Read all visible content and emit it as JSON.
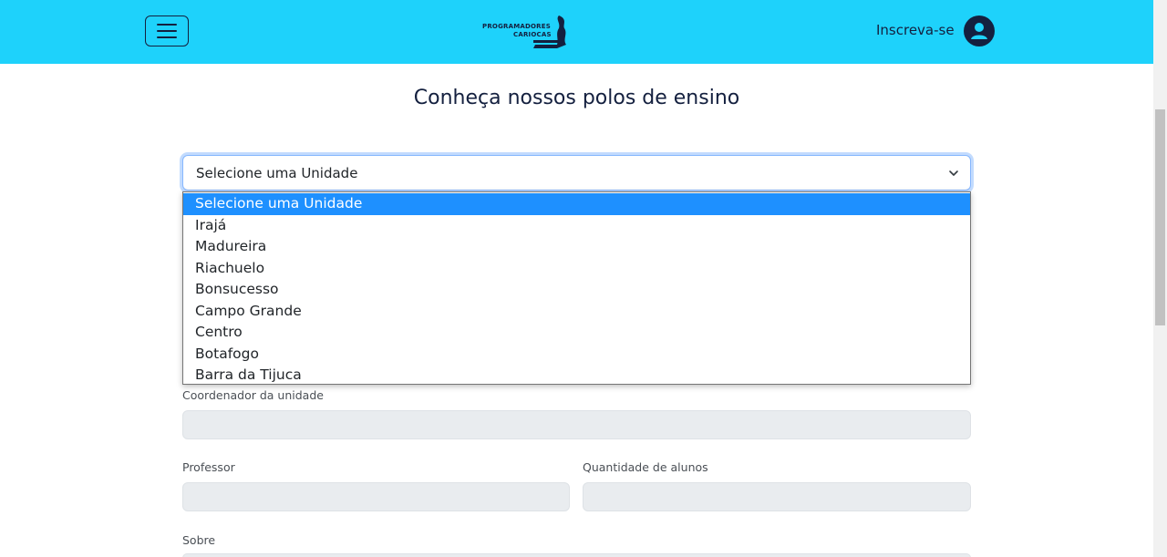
{
  "header": {
    "menu_icon": "hamburger-menu-icon",
    "logo_line1": "PROGRAMADORES",
    "logo_line2": "CARIOCAS",
    "signup_label": "Inscreva-se",
    "avatar_icon": "user-avatar-icon",
    "background_color": "#1ed2fb",
    "brand_color": "#14203f"
  },
  "main": {
    "title": "Conheça nossos polos de ensino",
    "unit_select": {
      "value": "Selecione uma Unidade",
      "options": [
        "Selecione uma Unidade",
        "Irajá",
        "Madureira",
        "Riachuelo",
        "Bonsucesso",
        "Campo Grande",
        "Centro",
        "Botafogo",
        "Barra da Tijuca"
      ],
      "selected_index": 0,
      "highlight_color": "#1e90ff"
    },
    "form": {
      "coordinator_label": "Coordenador da unidade",
      "teacher_label": "Professor",
      "students_label": "Quantidade de alunos",
      "about_label": "Sobre"
    }
  }
}
